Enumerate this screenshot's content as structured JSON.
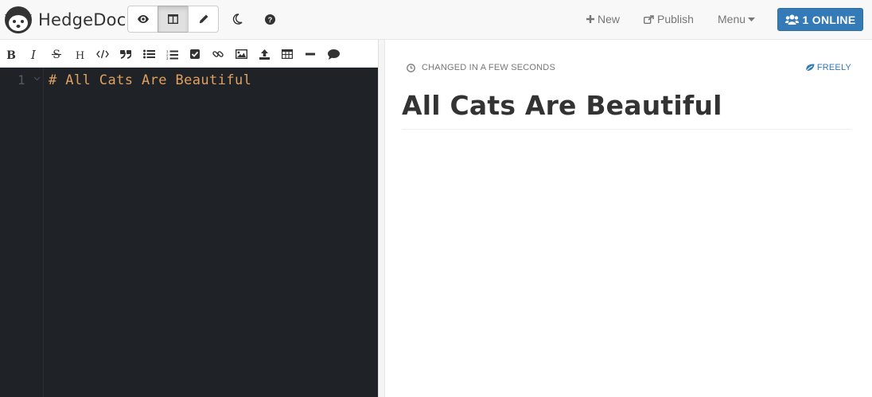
{
  "app": {
    "brand": "HedgeDoc"
  },
  "view_modes": [
    {
      "name": "view",
      "icon": "eye-icon"
    },
    {
      "name": "both",
      "icon": "columns-icon",
      "active": true
    },
    {
      "name": "edit",
      "icon": "pencil-icon"
    }
  ],
  "nav": {
    "night_mode_icon": "moon-icon",
    "help_icon": "question-circle-icon",
    "new_label": "New",
    "publish_label": "Publish",
    "menu_label": "Menu",
    "online_label": "1 ONLINE"
  },
  "toolbar": {
    "items": [
      "bold",
      "italic",
      "strikethrough",
      "header",
      "code",
      "quote",
      "unordered-list",
      "ordered-list",
      "checklist",
      "link",
      "image",
      "upload",
      "table",
      "horizontal-rule",
      "comment"
    ]
  },
  "editor": {
    "line_number": "1",
    "line_text": "# All Cats Are Beautiful"
  },
  "preview": {
    "changed_text": "CHANGED IN A FEW SECONDS",
    "permission_text": "FREELY",
    "title": "All Cats Are Beautiful"
  },
  "colors": {
    "accent": "#337ab7",
    "editor_bg": "#1f2226",
    "heading_syntax": "#e0a060"
  }
}
